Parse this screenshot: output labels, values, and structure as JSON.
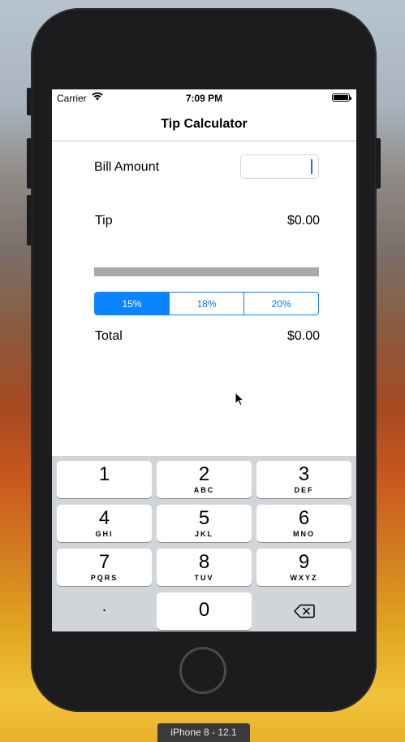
{
  "status_bar": {
    "carrier": "Carrier",
    "time": "7:09 PM"
  },
  "nav": {
    "title": "Tip Calculator"
  },
  "form": {
    "bill_label": "Bill Amount",
    "bill_value": "",
    "tip_label": "Tip",
    "tip_value": "$0.00",
    "total_label": "Total",
    "total_value": "$0.00"
  },
  "tip_options": [
    {
      "label": "15%",
      "selected": true
    },
    {
      "label": "18%",
      "selected": false
    },
    {
      "label": "20%",
      "selected": false
    }
  ],
  "keypad": {
    "keys": [
      {
        "num": "1",
        "letters": ""
      },
      {
        "num": "2",
        "letters": "ABC"
      },
      {
        "num": "3",
        "letters": "DEF"
      },
      {
        "num": "4",
        "letters": "GHI"
      },
      {
        "num": "5",
        "letters": "JKL"
      },
      {
        "num": "6",
        "letters": "MNO"
      },
      {
        "num": "7",
        "letters": "PQRS"
      },
      {
        "num": "8",
        "letters": "TUV"
      },
      {
        "num": "9",
        "letters": "WXYZ"
      },
      {
        "num": ".",
        "letters": ""
      },
      {
        "num": "0",
        "letters": ""
      }
    ],
    "delete_icon": "backspace-icon"
  },
  "simulator": {
    "device_label": "iPhone 8 - 12.1"
  },
  "colors": {
    "accent": "#0a84ff",
    "slider": "#a9a9a9",
    "keyboard_bg": "#d1d4d9"
  }
}
